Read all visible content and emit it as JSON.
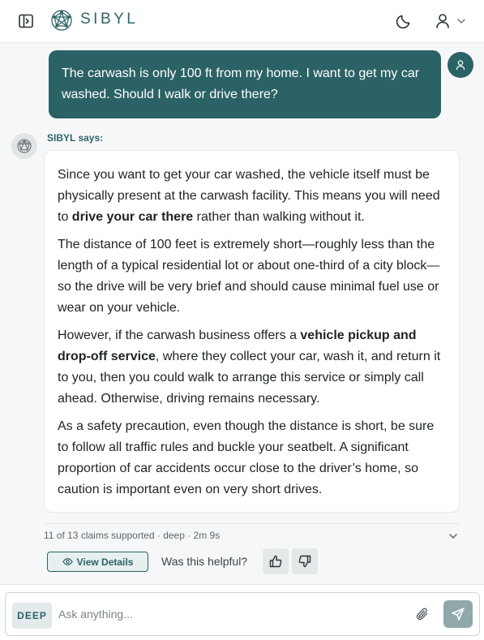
{
  "header": {
    "brand": "SIBYL"
  },
  "icons": {
    "sidebar_toggle": "sidebar-panel-icon",
    "logo": "sibyl-network-logo",
    "theme": "moon-icon",
    "user": "user-icon",
    "chevron": "chevron-down-icon",
    "eye": "eye-icon",
    "thumbs_up": "thumbs-up-icon",
    "thumbs_down": "thumbs-down-icon",
    "attach": "paperclip-icon",
    "send": "send-icon"
  },
  "colors": {
    "accent": "#2b6266",
    "user_bubble": "#2b6266",
    "page_background": "#f6f7f8",
    "send_button": "#8fa9aa"
  },
  "conversation": {
    "user_message": "The carwash is only 100 ft from my home. I want to get my car washed. Should I walk or drive there?",
    "assistant_label": "SIBYL says:",
    "answer": {
      "p1_a": "Since you want to get your car washed, the vehicle itself must be physically present at the carwash facility. This means you will need to ",
      "p1_bold": "drive your car there",
      "p1_b": " rather than walking without it.",
      "p2": "The distance of 100 feet is extremely short—roughly less than the length of a typical residential lot or about one-third of a city block—so the drive will be very brief and should cause minimal fuel use or wear on your vehicle.",
      "p3_a": "However, if the carwash business offers a ",
      "p3_bold": "vehicle pickup and drop-off service",
      "p3_b": ", where they collect your car, wash it, and return it to you, then you could walk to arrange this service or simply call ahead. Otherwise, driving remains necessary.",
      "p4": "As a safety precaution, even though the distance is short, be sure to follow all traffic rules and buckle your seatbelt. A significant proportion of car accidents occur close to the driver’s home, so caution is important even on very short drives."
    },
    "meta": "11 of 13 claims supported · deep · 2m 9s",
    "view_details_label": "View Details",
    "helpful_prompt": "Was this helpful?"
  },
  "composer": {
    "mode": "DEEP",
    "placeholder": "Ask anything..."
  }
}
